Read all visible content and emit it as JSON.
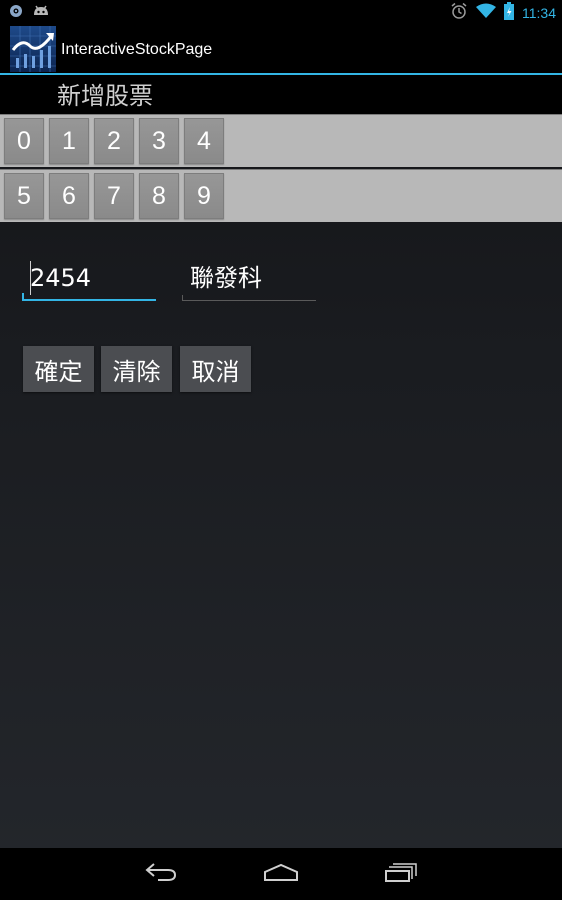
{
  "status_bar": {
    "time": "11:34",
    "left_icons": [
      "settings-icon",
      "android-icon"
    ],
    "right_icons": [
      "alarm-icon",
      "wifi-icon",
      "battery-icon"
    ]
  },
  "action_bar": {
    "title": "InteractiveStockPage",
    "icon": "stock-chart-app-icon"
  },
  "section": {
    "title": "新增股票"
  },
  "keypad": {
    "row1": [
      "0",
      "1",
      "2",
      "3",
      "4"
    ],
    "row2": [
      "5",
      "6",
      "7",
      "8",
      "9"
    ]
  },
  "form": {
    "code_value": "2454",
    "name_value": "聯發科"
  },
  "buttons": {
    "confirm": "確定",
    "clear": "清除",
    "cancel": "取消"
  },
  "nav_bar": {
    "icons": [
      "back-icon",
      "home-icon",
      "recent-apps-icon"
    ]
  },
  "colors": {
    "accent": "#33b5e5",
    "key_background": "#b8b8b8",
    "button_background": "#4b4d51"
  }
}
